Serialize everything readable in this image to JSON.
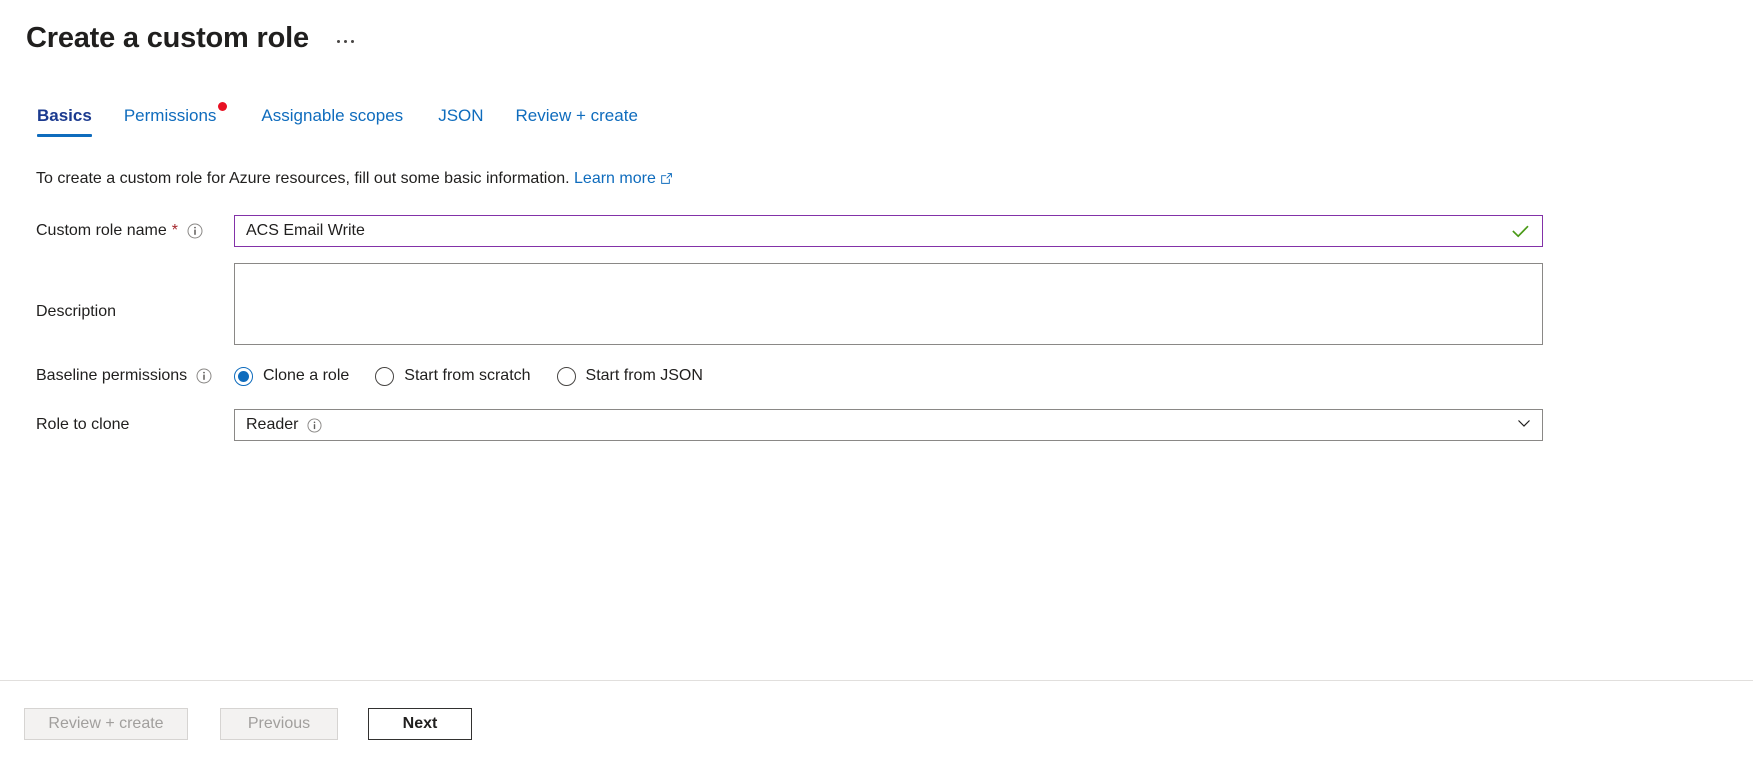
{
  "header": {
    "title": "Create a custom role",
    "more_menu": "ellipsis-menu"
  },
  "tabs": [
    {
      "label": "Basics",
      "selected": true,
      "badge": false
    },
    {
      "label": "Permissions",
      "selected": false,
      "badge": true
    },
    {
      "label": "Assignable scopes",
      "selected": false,
      "badge": false
    },
    {
      "label": "JSON",
      "selected": false,
      "badge": false
    },
    {
      "label": "Review + create",
      "selected": false,
      "badge": false
    }
  ],
  "intro": {
    "text": "To create a custom role for Azure resources, fill out some basic information.",
    "link_label": "Learn more"
  },
  "form": {
    "role_name": {
      "label": "Custom role name",
      "required_marker": "*",
      "value": "ACS Email Write",
      "placeholder": "",
      "validation": "valid"
    },
    "description": {
      "label": "Description",
      "value": "",
      "placeholder": ""
    },
    "baseline_permissions": {
      "label": "Baseline permissions",
      "options": [
        {
          "label": "Clone a role",
          "selected": true
        },
        {
          "label": "Start from scratch",
          "selected": false
        },
        {
          "label": "Start from JSON",
          "selected": false
        }
      ]
    },
    "role_to_clone": {
      "label": "Role to clone",
      "value": "Reader"
    }
  },
  "footer": {
    "review_label": "Review + create",
    "previous_label": "Previous",
    "next_label": "Next"
  },
  "colors": {
    "accent_blue": "#0f6cbd",
    "selected_tab": "#1b3a8f",
    "badge_red": "#e81123",
    "required_red": "#a4262c",
    "valid_green": "#4a9a17",
    "focus_purple": "#8332a8"
  }
}
